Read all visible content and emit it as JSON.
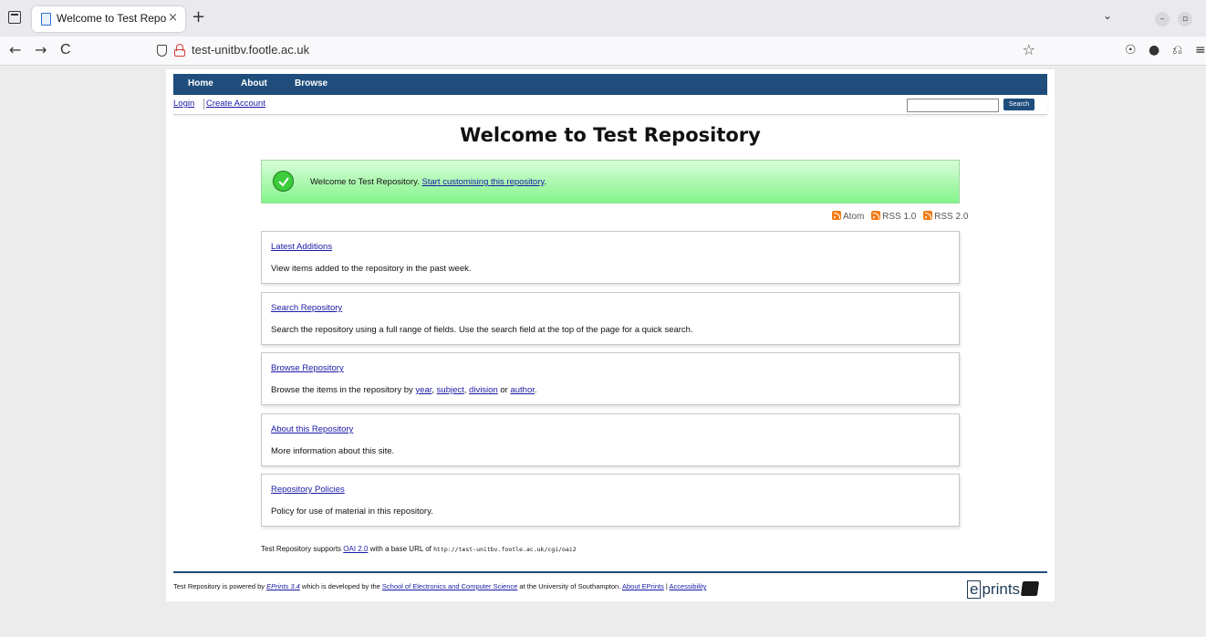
{
  "browser": {
    "tab_title": "Welcome to Test Reposit",
    "tab_close": "×",
    "new_tab": "+",
    "url": "test-unitbv.footle.ac.uk",
    "overflow": "⌄",
    "win_min": "–",
    "win_max": "▫",
    "nav_back": "←",
    "nav_forward": "→",
    "nav_reload": "C",
    "star": "☆",
    "pocket": "☉",
    "account": "●",
    "extensions": "⎌",
    "menu": "≡"
  },
  "menu": {
    "home": "Home",
    "about": "About",
    "browse": "Browse"
  },
  "userbar": {
    "login": "Login",
    "create_account": "Create Account",
    "search_button": "Search",
    "search_value": ""
  },
  "page_title": "Welcome to Test Repository",
  "welcome": {
    "text": "Welcome to Test Repository. ",
    "link": "Start customising this repository",
    "after": "."
  },
  "feeds": {
    "atom": "Atom",
    "rss1": "RSS 1.0",
    "rss2": "RSS 2.0"
  },
  "boxes": [
    {
      "title": "Latest Additions",
      "desc": "View items added to the repository in the past week."
    },
    {
      "title": "Search Repository",
      "desc": "Search the repository using a full range of fields. Use the search field at the top of the page for a quick search."
    },
    {
      "title": "Browse Repository",
      "desc_pre": "Browse the items in the repository by ",
      "link_year": "year",
      "sep1": ", ",
      "link_subject": "subject",
      "sep2": ", ",
      "link_division": "division",
      "sep3": " or ",
      "link_author": "author",
      "desc_post": "."
    },
    {
      "title": "About this Repository",
      "desc": "More information about this site."
    },
    {
      "title": "Repository Policies",
      "desc": "Policy for use of material in this repository."
    }
  ],
  "oai": {
    "pre": "Test Repository supports ",
    "link": "OAI 2.0",
    "mid": " with a base URL of ",
    "url": "http://test-unitbv.footle.ac.uk/cgi/oai2"
  },
  "footer": {
    "pre": "Test Repository is powered by ",
    "eprints_link": "EPrints 3.4",
    "mid": " which is developed by the ",
    "school_link": "School of Electronics and Computer Science",
    "post": " at the University of Southampton. ",
    "about_link": "About EPrints",
    "sep": " | ",
    "access_link": "Accessibility",
    "logo_e": "e",
    "logo_rest": "prints"
  }
}
